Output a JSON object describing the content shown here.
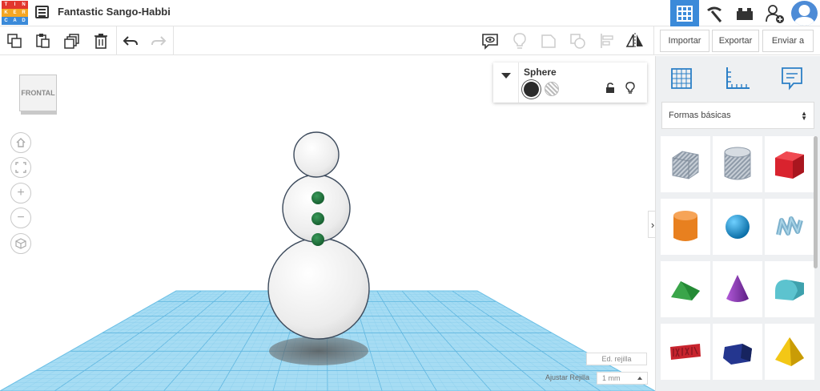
{
  "app": {
    "logo_letters": [
      "T",
      "I",
      "N",
      "K",
      "E",
      "R",
      "C",
      "A",
      "D"
    ],
    "logo_colors": [
      "#e2362e",
      "#e2362e",
      "#e2362e",
      "#f5a623",
      "#f5a623",
      "#f5a623",
      "#3b8ad9",
      "#3b8ad9",
      "#3b8ad9"
    ],
    "document_title": "Fantastic Sango-Habbi",
    "accent": "#3b8ad9"
  },
  "top_buttons": [
    "3d-view-icon",
    "pickaxe-icon",
    "bricks-icon",
    "add-user-icon",
    "avatar-icon"
  ],
  "toolbar": {
    "left_tools": [
      "copy-icon",
      "paste-icon",
      "duplicate-icon",
      "delete-icon",
      "undo-icon",
      "redo-icon"
    ],
    "right_tools": [
      "notes-visibility-icon",
      "light-icon",
      "group-icon",
      "ungroup-icon",
      "align-icon",
      "mirror-icon"
    ],
    "import_label": "Importar",
    "export_label": "Exportar",
    "send_label": "Enviar a"
  },
  "viewcube": {
    "face_label": "FRONTAL"
  },
  "inspector": {
    "shape_name": "Sphere",
    "solid_color": "#2b2b2b",
    "hole_selected": false
  },
  "workplane": {
    "edit_grid_label": "Ed. rejilla",
    "snap_label": "Ajustar Rejilla",
    "snap_value": "1 mm",
    "grid_color": "#8fd0ee"
  },
  "panel": {
    "tools": [
      "workplane-icon",
      "ruler-icon",
      "notes-icon"
    ],
    "category": "Formas básicas",
    "shapes": [
      {
        "name": "striped-box",
        "color": "#a9b4c0"
      },
      {
        "name": "striped-cylinder",
        "color": "#a9b4c0"
      },
      {
        "name": "box",
        "color": "#d9232e"
      },
      {
        "name": "cylinder",
        "color": "#e8801f"
      },
      {
        "name": "sphere",
        "color": "#1b9ad8"
      },
      {
        "name": "scribble",
        "color": "#7bb0cc"
      },
      {
        "name": "roof",
        "color": "#3aa54a"
      },
      {
        "name": "cone",
        "color": "#8a38b5"
      },
      {
        "name": "round-roof",
        "color": "#5cc3cf"
      },
      {
        "name": "text",
        "color": "#c8242e"
      },
      {
        "name": "polygon",
        "color": "#24368f"
      },
      {
        "name": "pyramid",
        "color": "#f3c716"
      }
    ]
  },
  "model": {
    "body_color": "#f4f4f4",
    "button_color": "#1f6b3a",
    "outline_color": "#3c4a5c"
  }
}
